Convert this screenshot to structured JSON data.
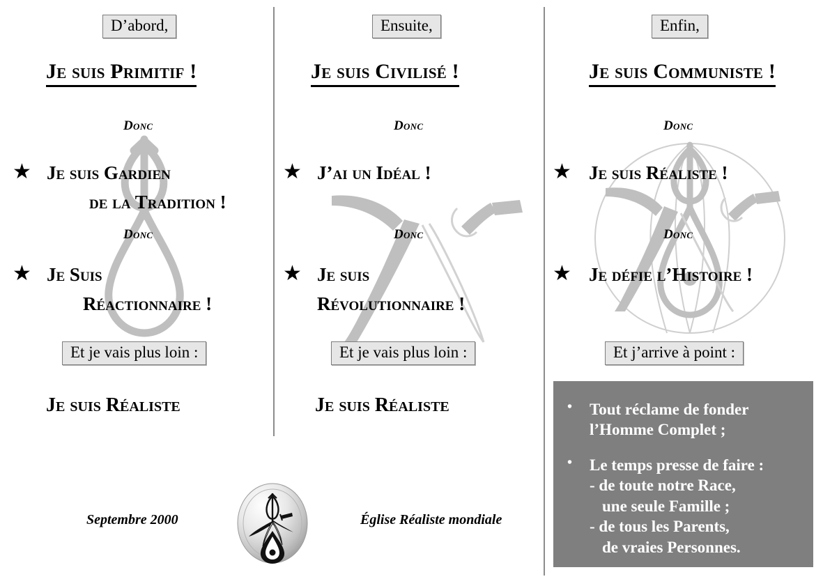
{
  "document": {
    "title": "Je suis Primitif / Civilisé / Communiste",
    "accent_grey": "#7f7f7f",
    "chip_fill": "#e6e6e6",
    "chip_border": "#7d7d7d",
    "divider_color": "#8c8c8c",
    "watermark_color": "#bfbfbf"
  },
  "columns": [
    {
      "chip_label": "D’abord,",
      "heading": "Je suis Primitif !",
      "donc_1": "Donc",
      "claim_1_line1": "Je suis Gardien",
      "claim_1_line2": "de la Tradition !",
      "donc_2": "Donc",
      "claim_2_line1": "Je Suis",
      "claim_2_line2": "Réactionnaire !",
      "footer_chip": "Et je vais plus loin :",
      "conclusion": "Je suis Réaliste",
      "star_glyph": "★",
      "watermark_name": "tulip-ankh-watermark"
    },
    {
      "chip_label": "Ensuite,",
      "heading": "Je suis Civilisé !",
      "donc_1": "Donc",
      "claim_1_line1": "J’ai un Idéal !",
      "claim_1_line2": "",
      "donc_2": "Donc",
      "claim_2_line1": "Je suis",
      "claim_2_line2": "Révolutionnaire !",
      "footer_chip": "Et je vais plus loin :",
      "conclusion": "Je suis Réaliste",
      "star_glyph": "★",
      "watermark_name": "dagger-wings-watermark"
    },
    {
      "chip_label": "Enfin,",
      "heading": "Je suis Communiste !",
      "donc_1": "Donc",
      "claim_1_line1": "Je suis Réaliste !",
      "claim_1_line2": "",
      "donc_2": "Donc",
      "claim_2_line1": "Je défie l’Histoire !",
      "claim_2_line2": "",
      "footer_chip": "Et j’arrive à point :",
      "conclusion": "",
      "star_glyph": "★",
      "watermark_name": "circle-emblem-watermark"
    }
  ],
  "callout": {
    "background": "#7f7f7f",
    "text_color": "#ffffff",
    "bullet_glyph": "•",
    "items": [
      {
        "line1": "Tout réclame de fonder",
        "line2": "l’Homme Complet ;",
        "line3": "",
        "line4": ""
      },
      {
        "line1": "Le temps presse de faire :",
        "line2": "- de toute notre Race,",
        "line3": "une seule Famille ;",
        "line4": "- de tous les Parents,",
        "line5": "de vraies Personnes."
      }
    ]
  },
  "footer": {
    "date": "Septembre 2000",
    "organisation": "Église Réaliste mondiale",
    "logo_name": "eglise-realiste-logo"
  }
}
